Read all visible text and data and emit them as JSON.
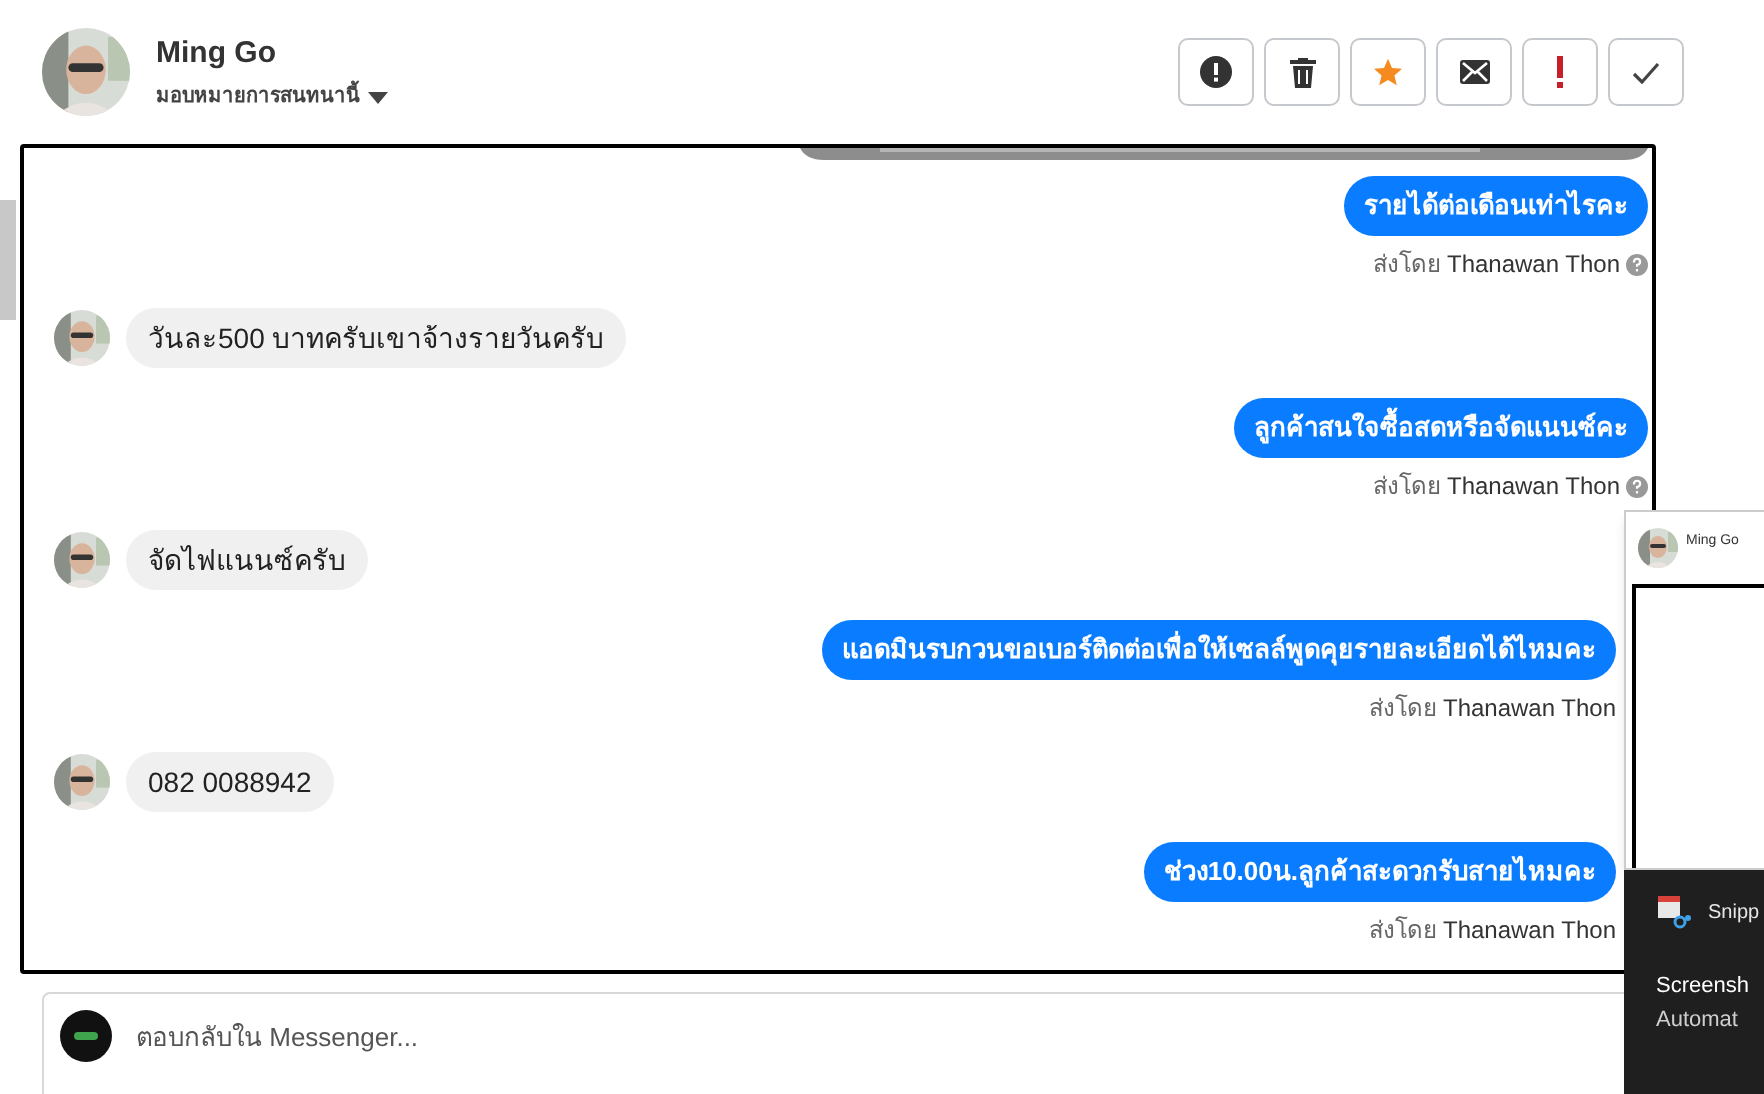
{
  "header": {
    "name": "Ming Go",
    "assign_label": "มอบหมายการสนทนานี้"
  },
  "toolbar": [
    {
      "kind": "alert"
    },
    {
      "kind": "trash"
    },
    {
      "kind": "star"
    },
    {
      "kind": "mail"
    },
    {
      "kind": "important"
    },
    {
      "kind": "check"
    }
  ],
  "messages": [
    {
      "kind": "agent",
      "text": "รายได้ต่อเดือนเท่าไรคะ",
      "sent_by_label": "ส่งโดย",
      "sender": "Thanawan Thon"
    },
    {
      "kind": "customer",
      "text": "วันละ500 บาทครับเขาจ้างรายวันครับ"
    },
    {
      "kind": "agent",
      "text": "ลูกค้าสนใจซื้อสดหรือจัดแนนซ์คะ",
      "sent_by_label": "ส่งโดย",
      "sender": "Thanawan Thon"
    },
    {
      "kind": "customer",
      "text": "จัดไฟแนนซ์ครับ"
    },
    {
      "kind": "agent",
      "text": "แอดมินรบกวนขอเบอร์ติดต่อเพื่อให้เซลล์พูดคุยรายละเอียดได้ไหมคะ",
      "sent_by_label": "ส่งโดย",
      "sender": "Thanawan Thon"
    },
    {
      "kind": "customer",
      "text": "082 0088942"
    },
    {
      "kind": "agent",
      "text": "ช่วง10.00น.ลูกค้าสะดวกรับสายไหมคะ",
      "sent_by_label": "ส่งโดย",
      "sender": "Thanawan Thon"
    }
  ],
  "composer": {
    "placeholder": "ตอบกลับใน Messenger..."
  },
  "popup": {
    "name": "Ming Go"
  },
  "notification": {
    "app": "Snipp",
    "title": "Screensh",
    "body": "Automat"
  }
}
